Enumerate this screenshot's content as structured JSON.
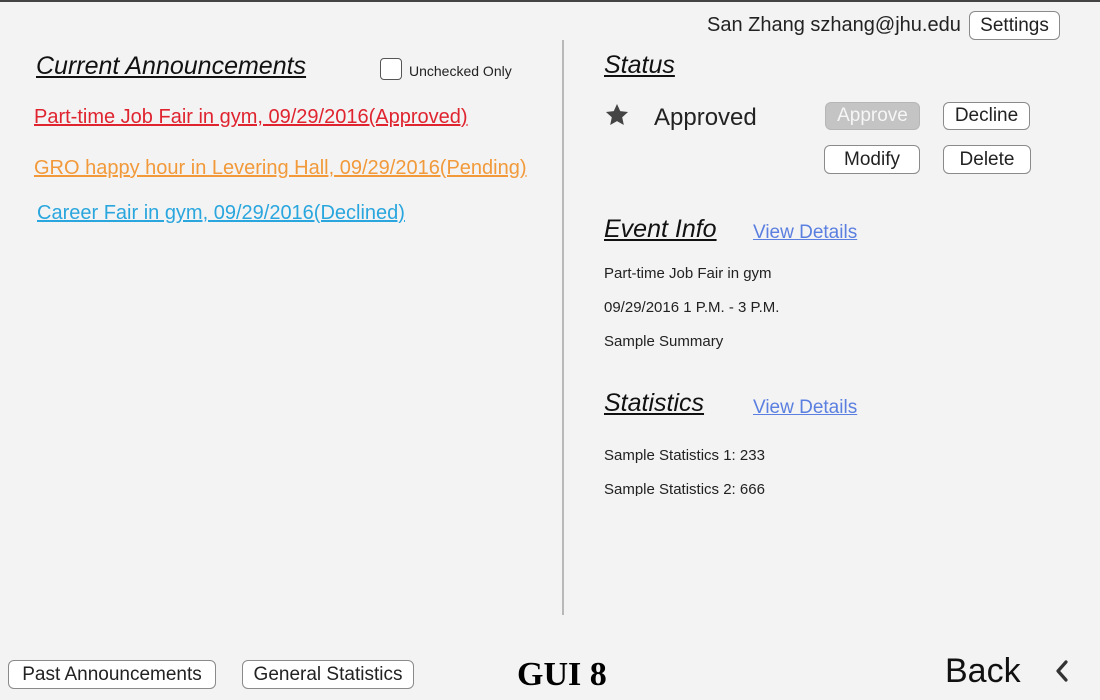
{
  "header": {
    "user": "San Zhang szhang@jhu.edu",
    "settings_label": "Settings"
  },
  "announcements": {
    "title": "Current Announcements",
    "filter_label": "Unchecked Only",
    "items": [
      {
        "text": "Part-time Job Fair in gym, 09/29/2016(Approved)",
        "color": "#e0242f"
      },
      {
        "text": "GRO happy hour in Levering Hall, 09/29/2016(Pending)",
        "color": "#f29a3a"
      },
      {
        "text": "Career Fair in gym, 09/29/2016(Declined)",
        "color": "#2aa6de"
      }
    ]
  },
  "status": {
    "title": "Status",
    "icon": "star-icon",
    "value": "Approved",
    "buttons": {
      "approve": "Approve",
      "decline": "Decline",
      "modify": "Modify",
      "delete": "Delete"
    }
  },
  "event_info": {
    "title": "Event Info",
    "link": "View Details",
    "name": "Part-time Job Fair in gym",
    "time": "09/29/2016 1 P.M. - 3 P.M.",
    "summary": "Sample Summary"
  },
  "statistics": {
    "title": "Statistics",
    "link": "View Details",
    "items": [
      "Sample Statistics 1: 233",
      "Sample Statistics 2: 666"
    ]
  },
  "footer": {
    "past_label": "Past Announcements",
    "general_label": "General Statistics",
    "caption": "GUI 8",
    "back_label": "Back",
    "back_icon": "chevron-left-icon"
  }
}
